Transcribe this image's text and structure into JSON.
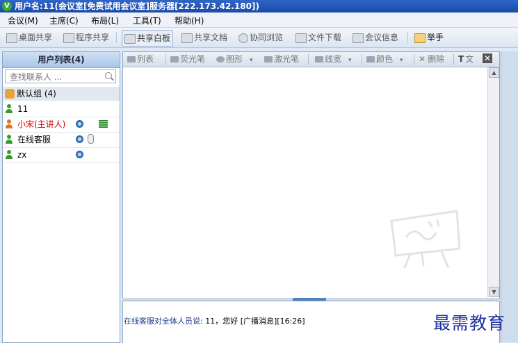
{
  "window": {
    "title": "用户名:11(会议室[免费试用会议室]服务器[222.173.42.180])"
  },
  "menu": {
    "items": [
      "会议(M)",
      "主席(C)",
      "布局(L)",
      "工具(T)",
      "帮助(H)"
    ]
  },
  "toolbar": {
    "buttons": [
      "桌面共享",
      "程序共享",
      "共享白板",
      "共享文档",
      "协同浏览",
      "文件下载",
      "会议信息",
      "举手"
    ],
    "active": "共享白板"
  },
  "user_panel": {
    "title": "用户列表(4)",
    "search_placeholder": "查找联系人 ...",
    "group_label": "默认组 (4)",
    "users": [
      {
        "name": "11",
        "role": "participant"
      },
      {
        "name": "小宋(主讲人)",
        "role": "host"
      },
      {
        "name": "在线客服",
        "role": "participant"
      },
      {
        "name": "zx",
        "role": "participant"
      }
    ]
  },
  "whiteboard": {
    "tools": [
      "列表",
      "荧光笔",
      "图形",
      "激光笔",
      "线宽",
      "颜色",
      "删除",
      "文"
    ]
  },
  "chat": {
    "sender_text": "在线客服对全体人员说: ",
    "message": "11，您好",
    "tag": " [广播消息][16:26]"
  },
  "brand": {
    "text": "最需教育"
  },
  "colors": {
    "title_bar": "#1b4aa8",
    "host_name": "#d40000",
    "brand_text": "#1e2fa0"
  }
}
